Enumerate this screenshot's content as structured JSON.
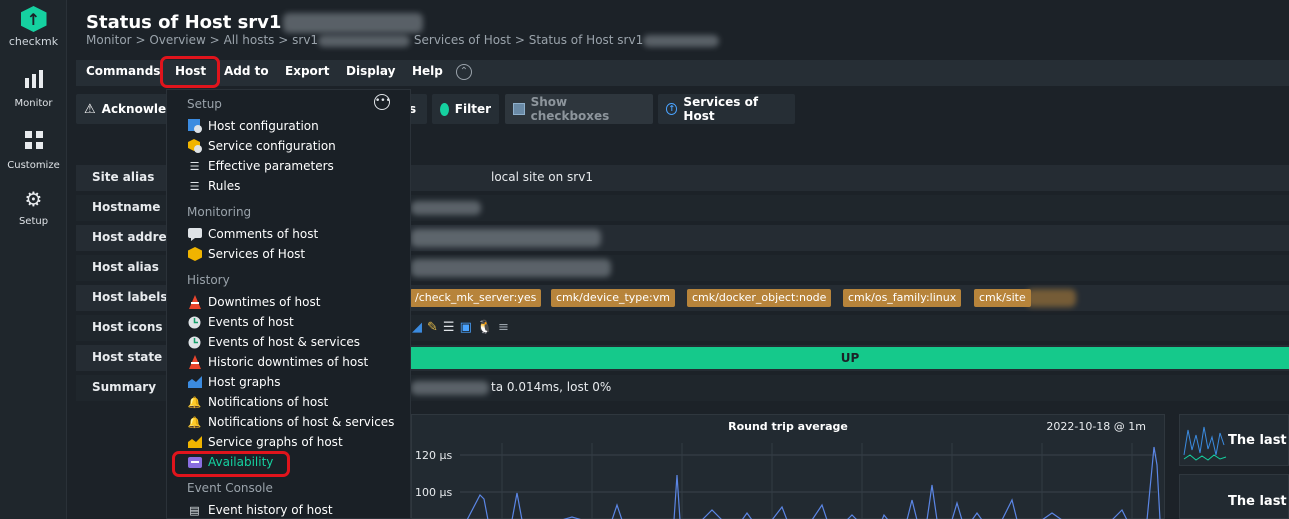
{
  "brand": {
    "name": "checkmk"
  },
  "sidebar": [
    {
      "label": "Monitor",
      "icon": "bar-chart-icon"
    },
    {
      "label": "Customize",
      "icon": "grid-icon"
    },
    {
      "label": "Setup",
      "icon": "gear-icon"
    }
  ],
  "header": {
    "title": "Status of Host srv1",
    "breadcrumb": [
      "Monitor",
      "Overview",
      "All hosts",
      "srv1",
      "Services of Host",
      "Status of Host srv1"
    ],
    "sep": ">"
  },
  "menubar": [
    "Commands",
    "Host",
    "Add to",
    "Export",
    "Display",
    "Help"
  ],
  "toolbar": {
    "acknowledge": "Acknowle",
    "partial": "s",
    "filter": "Filter",
    "show_checkboxes": "Show checkboxes",
    "services_of_host": "Services of Host"
  },
  "dropdown": {
    "sections": [
      {
        "title": "Setup",
        "items": [
          {
            "label": "Host configuration",
            "icon": "host-config-icon"
          },
          {
            "label": "Service configuration",
            "icon": "service-config-icon"
          },
          {
            "label": "Effective parameters",
            "icon": "parameters-icon"
          },
          {
            "label": "Rules",
            "icon": "rules-icon"
          }
        ]
      },
      {
        "title": "Monitoring",
        "items": [
          {
            "label": "Comments of host",
            "icon": "comment-icon"
          },
          {
            "label": "Services of Host",
            "icon": "services-icon"
          }
        ]
      },
      {
        "title": "History",
        "items": [
          {
            "label": "Downtimes of host",
            "icon": "downtime-icon"
          },
          {
            "label": "Events of host",
            "icon": "events-icon"
          },
          {
            "label": "Events of host & services",
            "icon": "events-icon"
          },
          {
            "label": "Historic downtimes of host",
            "icon": "downtime-icon"
          },
          {
            "label": "Host graphs",
            "icon": "graph-icon"
          },
          {
            "label": "Notifications of host",
            "icon": "bell-icon"
          },
          {
            "label": "Notifications of host & services",
            "icon": "bell-icon"
          },
          {
            "label": "Service graphs of host",
            "icon": "graph-icon"
          },
          {
            "label": "Availability",
            "icon": "availability-icon"
          }
        ]
      },
      {
        "title": "Event Console",
        "items": [
          {
            "label": "Event history of host",
            "icon": "event-history-icon"
          }
        ]
      }
    ]
  },
  "table": {
    "labels": [
      "Site alias",
      "Hostname",
      "Host address",
      "Host alias",
      "Host labels",
      "Host icons",
      "Host state",
      "Summary"
    ],
    "site_alias": "local site on srv1",
    "host_labels": [
      "/check_mk_server:yes",
      "cmk/device_type:vm",
      "cmk/docker_object:node",
      "cmk/os_family:linux",
      "cmk/site"
    ],
    "host_state": "UP",
    "summary": "ta 0.014ms, lost 0%"
  },
  "graph": {
    "title": "Round trip average",
    "date": "2022-10-18 @ 1m",
    "ticks": [
      "120 µs",
      "100 µs"
    ],
    "mini1_text": "The last",
    "mini2_text": "The last"
  },
  "colors": {
    "accent": "#15d1a0",
    "up": "#15c98b",
    "highlight": "#e0141c",
    "tag": "#b7843b"
  }
}
